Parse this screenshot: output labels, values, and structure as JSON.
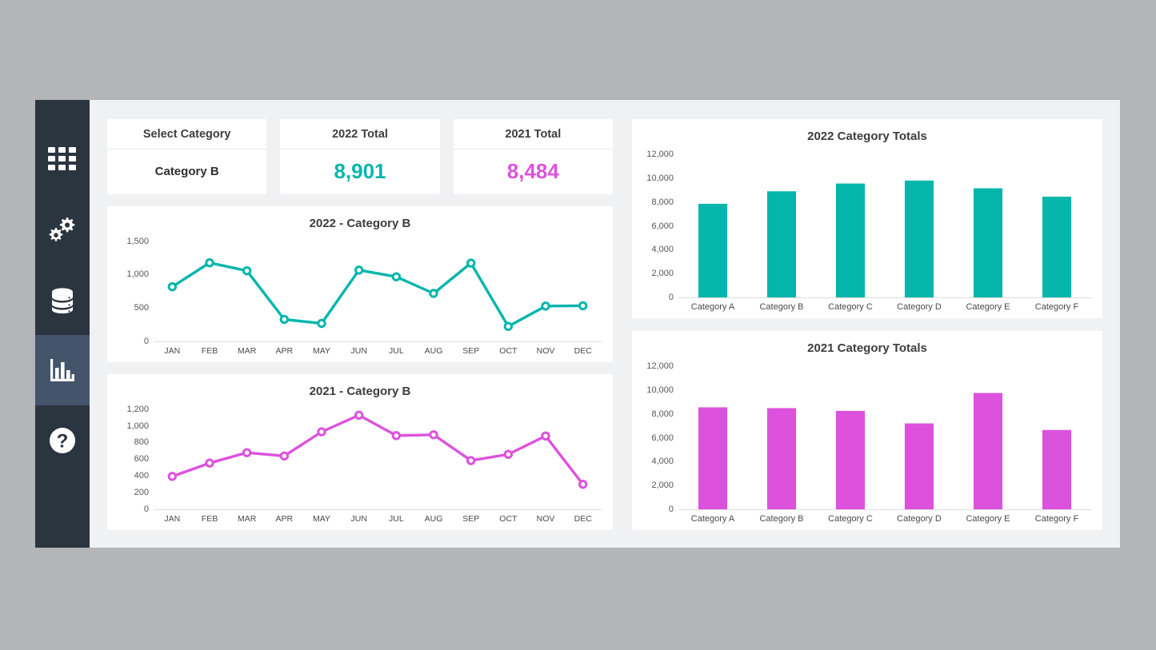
{
  "sidebar": {
    "items": [
      {
        "name": "apps-grid",
        "icon": "grid-icon",
        "active": false
      },
      {
        "name": "settings",
        "icon": "gears-icon",
        "active": false
      },
      {
        "name": "database",
        "icon": "database-icon",
        "active": false
      },
      {
        "name": "reports",
        "icon": "bar-chart-icon",
        "active": true
      },
      {
        "name": "help",
        "icon": "question-circle-icon",
        "active": false
      }
    ]
  },
  "kpis": [
    {
      "label": "Select Category",
      "value": "Category B",
      "style": "plain",
      "color": "#2f2f2f"
    },
    {
      "label": "2022 Total",
      "value": "8,901",
      "style": "big",
      "color": "#06b6ac"
    },
    {
      "label": "2021 Total",
      "value": "8,484",
      "style": "big",
      "color": "#dd52dd"
    }
  ],
  "colors": {
    "teal": "#06b6ac",
    "magenta": "#dd52dd",
    "sidebar": "#2b3540",
    "sidebar_active": "#44546a",
    "content_bg": "#f0f1f3",
    "card_bg": "#ffffff",
    "page_bg": "#b4b5b7"
  },
  "chart_data": [
    {
      "id": "line-2022",
      "type": "line",
      "title": "2022 - Category B",
      "xlabel": "",
      "ylabel": "",
      "categories": [
        "JAN",
        "FEB",
        "MAR",
        "APR",
        "MAY",
        "JUN",
        "JUL",
        "AUG",
        "SEP",
        "OCT",
        "NOV",
        "DEC"
      ],
      "values": [
        820,
        1180,
        1060,
        330,
        270,
        1070,
        970,
        720,
        1175,
        225,
        530,
        535
      ],
      "yticks": [
        0,
        500,
        1000,
        1500
      ],
      "ytick_labels": [
        "0",
        "500",
        "1,000",
        "1,500"
      ],
      "ylim": [
        0,
        1500
      ],
      "color": "#06b6ac",
      "marker": "open-circle",
      "grid": false,
      "legend": "none"
    },
    {
      "id": "line-2021",
      "type": "line",
      "title": "2021 - Category B",
      "xlabel": "",
      "ylabel": "",
      "categories": [
        "JAN",
        "FEB",
        "MAR",
        "APR",
        "MAY",
        "JUN",
        "JUL",
        "AUG",
        "SEP",
        "OCT",
        "NOV",
        "DEC"
      ],
      "values": [
        395,
        555,
        680,
        640,
        930,
        1130,
        885,
        895,
        585,
        660,
        880,
        300
      ],
      "yticks": [
        0,
        200,
        400,
        600,
        800,
        1000,
        1200
      ],
      "ytick_labels": [
        "0",
        "200",
        "400",
        "600",
        "800",
        "1,000",
        "1,200"
      ],
      "ylim": [
        0,
        1200
      ],
      "color": "#dd52dd",
      "marker": "open-circle",
      "grid": false,
      "legend": "none"
    },
    {
      "id": "bar-2022",
      "type": "bar",
      "title": "2022 Category Totals",
      "xlabel": "",
      "ylabel": "",
      "categories": [
        "Category A",
        "Category B",
        "Category C",
        "Category D",
        "Category E",
        "Category F"
      ],
      "values": [
        7850,
        8901,
        9550,
        9800,
        9150,
        8450
      ],
      "yticks": [
        0,
        2000,
        4000,
        6000,
        8000,
        10000,
        12000
      ],
      "ytick_labels": [
        "0",
        "2,000",
        "4,000",
        "6,000",
        "8,000",
        "10,000",
        "12,000"
      ],
      "ylim": [
        0,
        12000
      ],
      "color": "#06b6ac",
      "grid": false,
      "legend": "none"
    },
    {
      "id": "bar-2021",
      "type": "bar",
      "title": "2021 Category Totals",
      "xlabel": "",
      "ylabel": "",
      "categories": [
        "Category A",
        "Category B",
        "Category C",
        "Category D",
        "Category E",
        "Category F"
      ],
      "values": [
        8550,
        8484,
        8250,
        7200,
        9750,
        6650
      ],
      "yticks": [
        0,
        2000,
        4000,
        6000,
        8000,
        10000,
        12000
      ],
      "ytick_labels": [
        "0",
        "2,000",
        "4,000",
        "6,000",
        "8,000",
        "10,000",
        "12,000"
      ],
      "ylim": [
        0,
        12000
      ],
      "color": "#dd52dd",
      "grid": false,
      "legend": "none"
    }
  ]
}
